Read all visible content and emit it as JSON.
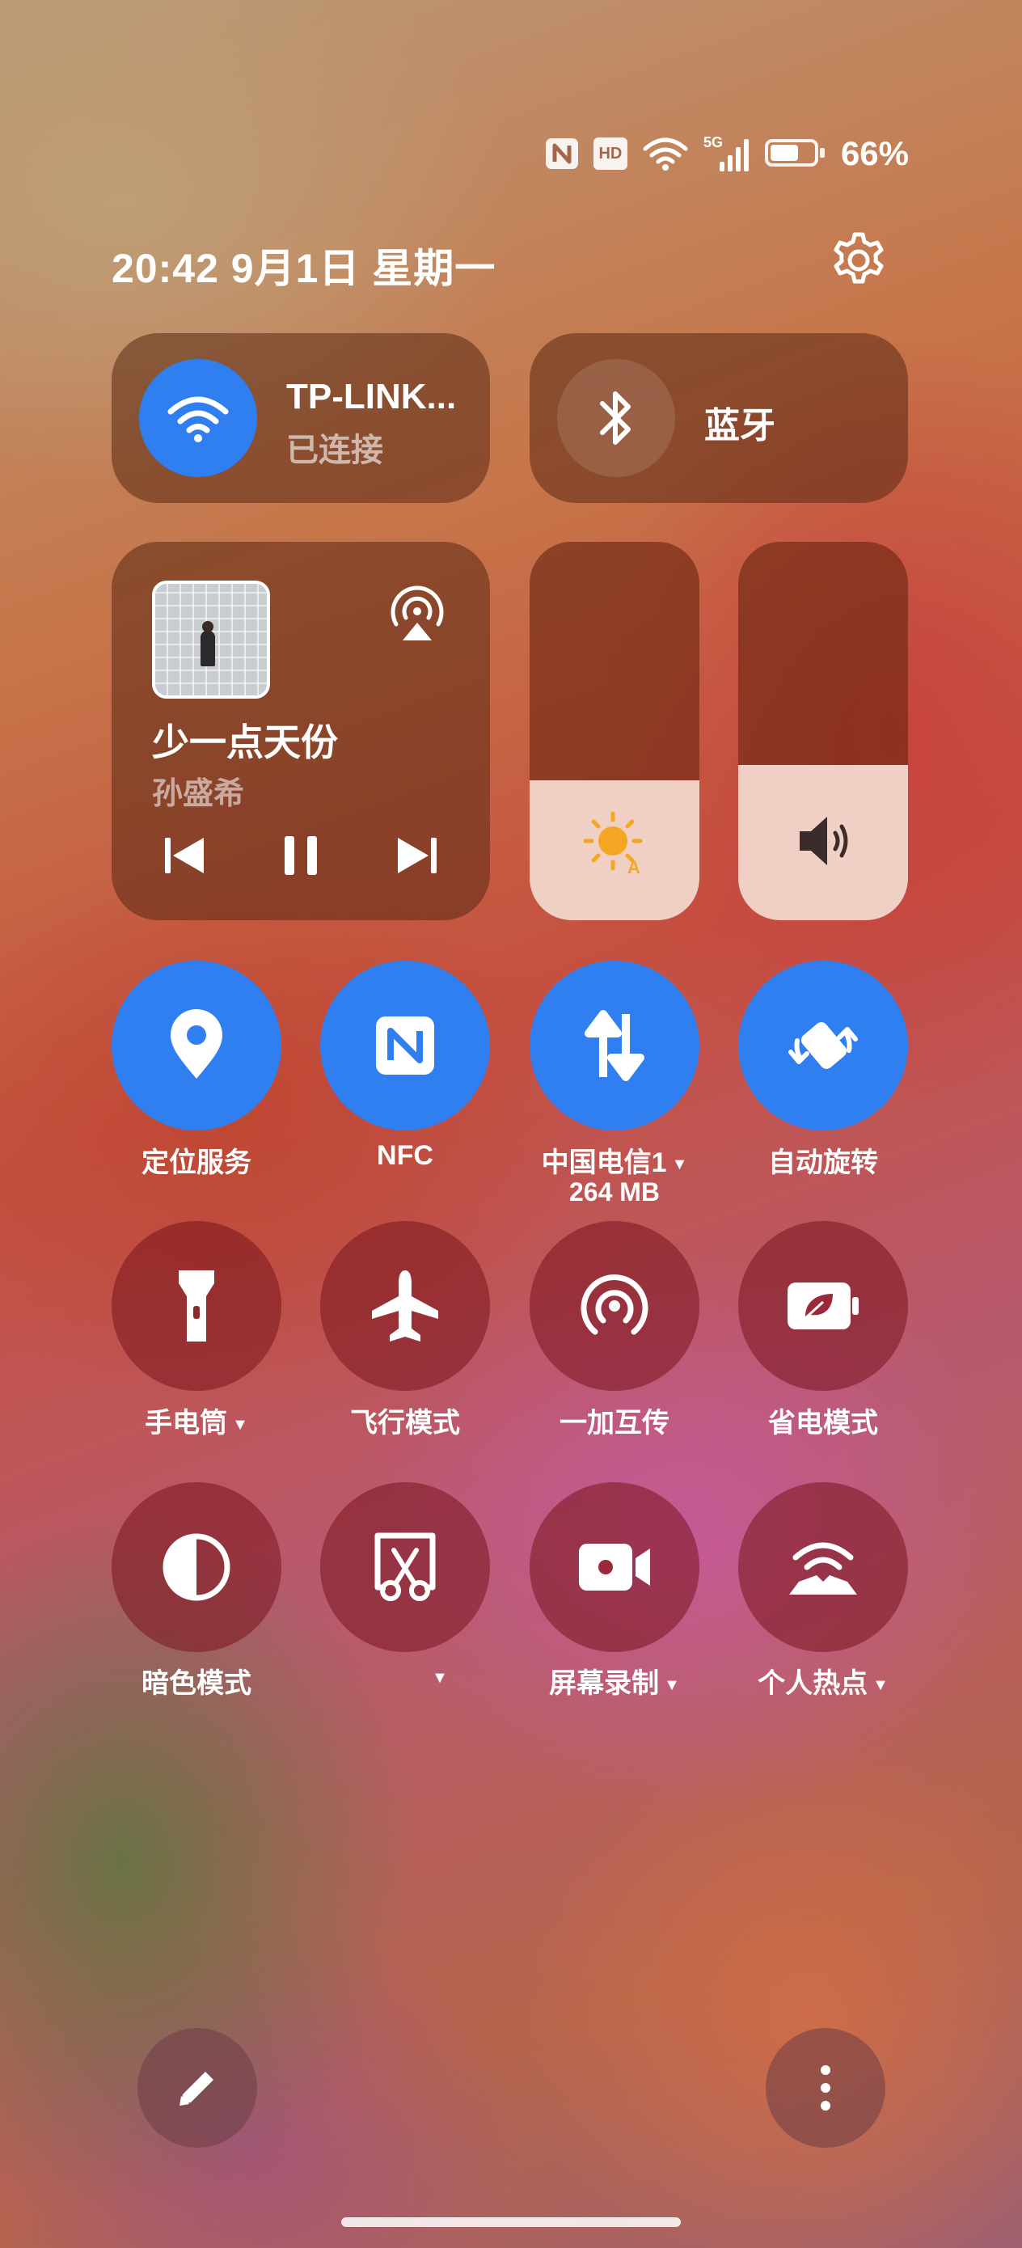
{
  "status_bar": {
    "icons": [
      "nfc-icon",
      "hd-icon",
      "wifi-icon",
      "5g-signal-icon",
      "battery-icon"
    ],
    "hd_label": "HD",
    "net_label": "5G",
    "battery_percent": "66%",
    "battery_level": 0.66
  },
  "header": {
    "datetime": "20:42  9月1日 星期一",
    "settings_icon": "gear-icon"
  },
  "wifi": {
    "name": "TP-LINK...",
    "status": "已连接",
    "icon": "wifi-icon",
    "active": true
  },
  "bluetooth": {
    "label": "蓝牙",
    "icon": "bluetooth-icon",
    "active": false
  },
  "media": {
    "title": "少一点天份",
    "artist": "孙盛希",
    "controls": [
      "previous-icon",
      "pause-icon",
      "next-icon"
    ],
    "cast_icon": "cast-icon"
  },
  "brightness": {
    "level": 0.37,
    "icon": "auto-brightness-icon"
  },
  "volume": {
    "level": 0.41,
    "icon": "volume-icon"
  },
  "tiles_row1": [
    {
      "label": "定位服务",
      "icon": "location-icon",
      "active": true
    },
    {
      "label": "NFC",
      "icon": "nfc-icon",
      "active": true
    },
    {
      "label": "中国电信1",
      "sub": "264 MB",
      "icon": "mobile-data-icon",
      "active": true,
      "has_menu": true
    },
    {
      "label": "自动旋转",
      "icon": "auto-rotate-icon",
      "active": true
    }
  ],
  "tiles_row2": [
    {
      "label": "手电筒",
      "icon": "flashlight-icon",
      "active": false,
      "has_menu": true
    },
    {
      "label": "飞行模式",
      "icon": "airplane-icon",
      "active": false
    },
    {
      "label": "一加互传",
      "icon": "share-icon",
      "active": false
    },
    {
      "label": "省电模式",
      "icon": "battery-saver-icon",
      "active": false
    }
  ],
  "tiles_row3": [
    {
      "label": "暗色模式",
      "icon": "dark-mode-icon",
      "active": false
    },
    {
      "label": "",
      "icon": "screenshot-icon",
      "active": false,
      "has_menu": true
    },
    {
      "label": "屏幕录制",
      "icon": "screen-record-icon",
      "active": false,
      "has_menu": true
    },
    {
      "label": "个人热点",
      "icon": "hotspot-icon",
      "active": false,
      "has_menu": true
    }
  ],
  "bottom": {
    "edit_icon": "edit-icon",
    "more_icon": "more-icon"
  },
  "colors": {
    "accent": "#2f7ff0",
    "brightness_sun": "#f5a623"
  }
}
